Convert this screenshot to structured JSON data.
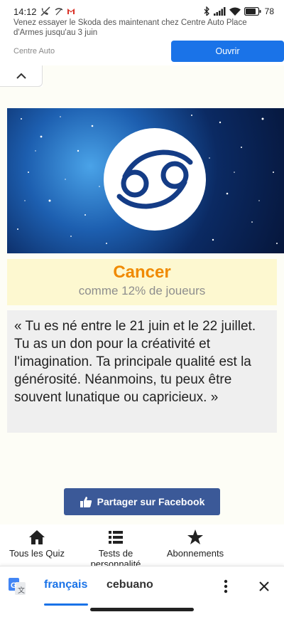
{
  "status_bar": {
    "time": "14:12",
    "battery": "78"
  },
  "ad": {
    "text": "Venez essayer le Skoda des maintenant chez Centre Auto Place d'Armes jusqu'au 3 juin",
    "source": "Centre Auto",
    "button_label": "Ouvrir"
  },
  "result": {
    "title": "Cancer",
    "subtitle": "comme 12% de joueurs",
    "description": "« Tu es né entre le 21 juin et le 22 juillet. Tu as un don pour la créativité et l'imagination. Ta principale qualité est la générosité. Néanmoins, tu peux être souvent lunatique ou capricieux. »"
  },
  "share": {
    "facebook_label": "Partager sur Facebook"
  },
  "bottom_nav": {
    "items": [
      {
        "label": "Tous les Quiz",
        "icon": "home-icon"
      },
      {
        "label": "Tests de personnalité",
        "icon": "list-icon"
      },
      {
        "label": "Abonnements",
        "icon": "star-icon"
      }
    ]
  },
  "translate_bar": {
    "active_language": "français",
    "other_language": "cebuano"
  },
  "colors": {
    "accent": "#1a73e8",
    "result_title": "#f08a00",
    "facebook": "#3b5998",
    "result_bg": "#fdf8d0"
  }
}
